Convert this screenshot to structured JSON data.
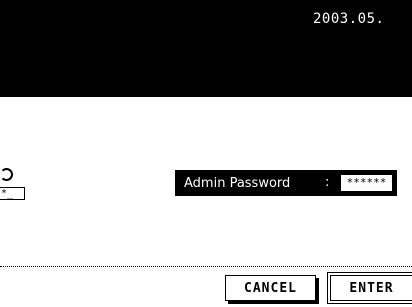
{
  "header": {
    "date_text": "2003.05."
  },
  "login": {
    "key_icon_mask": "*_",
    "password_label": "Admin Password",
    "separator": ":",
    "password_value": "******"
  },
  "actions": {
    "cancel_label": "CANCEL",
    "enter_label": "ENTER"
  }
}
